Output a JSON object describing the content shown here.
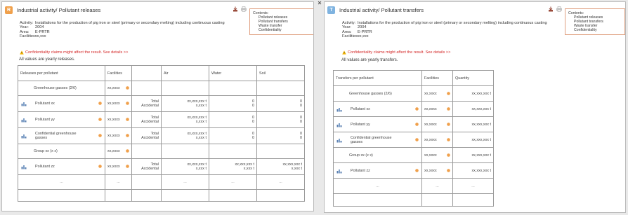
{
  "left_panel": {
    "badge_letter": "R",
    "badge_color": "#f0a04b",
    "title": "Industrial activity/ Pollutant releases",
    "contents": {
      "title": "Contents:",
      "items": [
        "Pollutant releases",
        "Pollutant transfers",
        "Waste transfer",
        "Confidentiality"
      ]
    },
    "activity_label": "Activity:",
    "activity_value": "Installations for the production of pig iron or steel (primary or secondary melting) including continuous casting",
    "year_label": "Year:",
    "year_value": "2004",
    "area_label": "Area:",
    "area_value": "E-PRTR",
    "facilities_label": "Facilities:",
    "facilities_value": "xx,xxx",
    "warning": "Confidentiality claims might affect the result. See details >>",
    "note": "All values are yearly releases.",
    "table": {
      "headers": [
        "Releases per pollutant",
        "Facilities",
        "",
        "Air",
        "Water",
        "Soil"
      ],
      "rows": [
        {
          "kind": "group",
          "label": "Greenhouse gasses (2/6)",
          "facilities": "xx,xxxx"
        },
        {
          "kind": "pollutant",
          "label": "Pollutant xx",
          "facilities": "xx,xxxx",
          "type_total": "Total",
          "type_accidental": "Accidental",
          "air_total": "xx,xxx,xxx t",
          "air_acc": "x,xxx t",
          "water_total": "0",
          "water_acc": "0",
          "soil_total": "0",
          "soil_acc": "0"
        },
        {
          "kind": "pollutant",
          "label": "Pollutant yy",
          "facilities": "xx,xxxx",
          "type_total": "Total",
          "type_accidental": "Accidental",
          "air_total": "xx,xxx,xxx t",
          "air_acc": "x,xxx t",
          "water_total": "0",
          "water_acc": "0",
          "soil_total": "0",
          "soil_acc": "0"
        },
        {
          "kind": "pollutant",
          "label": "Confidential greenhouse gasses",
          "facilities": "xx,xxxx",
          "type_total": "Total",
          "type_accidental": "Accidental",
          "air_total": "xx,xxx,xxx t",
          "air_acc": "x,xxx t",
          "water_total": "0",
          "water_acc": "0",
          "soil_total": "0",
          "soil_acc": "0"
        },
        {
          "kind": "group",
          "label": "Group xx (x x)",
          "facilities": "xx,xxxx"
        },
        {
          "kind": "pollutant",
          "label": "Pollutant zz",
          "facilities": "xx,xxxx",
          "type_total": "Total",
          "type_accidental": "Accidental",
          "air_total": "xx,xxx,xxx t",
          "air_acc": "x,xxx t",
          "water_total": "xx,xxx,xxx t",
          "water_acc": "x,xxx t",
          "soil_total": "xx,xxx,xxx t",
          "soil_acc": "x,xxx t"
        }
      ],
      "ellipsis": "..."
    }
  },
  "right_panel": {
    "badge_letter": "T",
    "badge_color": "#7fb3e0",
    "title": "Industrial activity/ Pollutant transfers",
    "contents": {
      "title": "Contents:",
      "items": [
        "Pollutant releases",
        "Pollutant transfers",
        "Waste transfer",
        "Confidentiality"
      ]
    },
    "activity_label": "Activity:",
    "activity_value": "Installations for the production of pig iron or steel (primary or secondary melting) including continuous casting",
    "year_label": "Year:",
    "year_value": "2004",
    "area_label": "Area:",
    "area_value": "E-PRTR",
    "facilities_label": "Facilities:",
    "facilities_value": "xx,xxx",
    "warning": "Confidentiality claims might affect the result. See details >>",
    "note": "All values are yearly transfers.",
    "table": {
      "headers": [
        "Transfers per pollutant",
        "Facilities",
        "Quantity"
      ],
      "rows": [
        {
          "kind": "group",
          "label": "Greenhouse gasses (2/6)",
          "facilities": "xx,xxxx",
          "quantity": "xx,xxx,xxx t"
        },
        {
          "kind": "pollutant",
          "label": "Pollutant xx",
          "facilities": "xx,xxxx",
          "quantity": "xx,xxx,xxx t"
        },
        {
          "kind": "pollutant",
          "label": "Pollutant yy",
          "facilities": "xx,xxxx",
          "quantity": "xx,xxx,xxx t"
        },
        {
          "kind": "pollutant",
          "label": "Confidential greenhouse gasses",
          "facilities": "xx,xxxx",
          "quantity": "xx,xxx,xxx t"
        },
        {
          "kind": "group",
          "label": "Group xx (x x)",
          "facilities": "xx,xxxx",
          "quantity": "xx,xxx,xxx t"
        },
        {
          "kind": "pollutant",
          "label": "Pollutant zz",
          "facilities": "xx,xxxx",
          "quantity": "xx,xxx,xxx t"
        }
      ],
      "ellipsis": "..."
    }
  },
  "icons": {
    "download": "download-icon",
    "print": "print-icon",
    "chart": "bar-chart-icon",
    "info_dot": "orange-info-icon",
    "warning": "warning-icon",
    "close": "close-icon"
  },
  "colors": {
    "warning_text": "#d42a2a",
    "info_dot": "#f0a04b",
    "contents_border": "#e0a080"
  }
}
